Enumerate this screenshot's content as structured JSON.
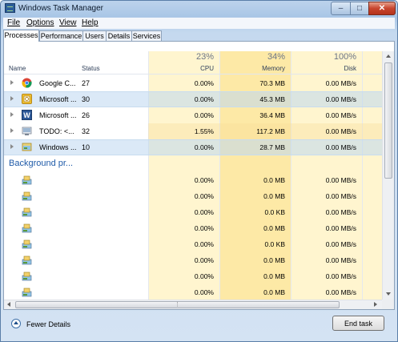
{
  "window": {
    "title": "Windows Task Manager",
    "controls": {
      "minimize": "–",
      "maximize": "□",
      "close": "✕"
    }
  },
  "menu": [
    "File",
    "Options",
    "View",
    "Help"
  ],
  "tabs": [
    {
      "label": "Processes",
      "active": true
    },
    {
      "label": "Performance",
      "active": false
    },
    {
      "label": "Users",
      "active": false
    },
    {
      "label": "Details",
      "active": false
    },
    {
      "label": "Services",
      "active": false
    }
  ],
  "columns": {
    "name": "Name",
    "status": "Status",
    "cpu": {
      "percent": "23%",
      "label": "CPU"
    },
    "memory": {
      "percent": "34%",
      "label": "Memory"
    },
    "disk": {
      "percent": "100%",
      "label": "Disk"
    }
  },
  "apps": [
    {
      "name": "Google C...",
      "status": "27",
      "cpu": "0.00%",
      "memory": "70.3 MB",
      "disk": "0.00 MB/s",
      "icon": "chrome-icon"
    },
    {
      "name": "Microsoft ...",
      "status": "30",
      "cpu": "0.00%",
      "memory": "45.3 MB",
      "disk": "0.00 MB/s",
      "icon": "outlook-icon"
    },
    {
      "name": "Microsoft ...",
      "status": "26",
      "cpu": "0.00%",
      "memory": "36.4 MB",
      "disk": "0.00 MB/s",
      "icon": "word-icon"
    },
    {
      "name": "TODO: <...",
      "status": "32",
      "cpu": "1.55%",
      "memory": "117.2 MB",
      "disk": "0.00 MB/s",
      "icon": "todo-app-icon"
    },
    {
      "name": "Windows ...",
      "status": "10",
      "cpu": "0.00%",
      "memory": "28.7 MB",
      "disk": "0.00 MB/s",
      "icon": "windows-explorer-icon"
    }
  ],
  "background_section": "Background pr...",
  "background": [
    {
      "cpu": "0.00%",
      "memory": "0.0 MB",
      "disk": "0.00 MB/s"
    },
    {
      "cpu": "0.00%",
      "memory": "0.0 MB",
      "disk": "0.00 MB/s"
    },
    {
      "cpu": "0.00%",
      "memory": "0.0 KB",
      "disk": "0.00 MB/s"
    },
    {
      "cpu": "0.00%",
      "memory": "0.0 MB",
      "disk": "0.00 MB/s"
    },
    {
      "cpu": "0.00%",
      "memory": "0.0 KB",
      "disk": "0.00 MB/s"
    },
    {
      "cpu": "0.00%",
      "memory": "0.0 MB",
      "disk": "0.00 MB/s"
    },
    {
      "cpu": "0.00%",
      "memory": "0.0 MB",
      "disk": "0.00 MB/s"
    },
    {
      "cpu": "0.00%",
      "memory": "0.0 MB",
      "disk": "0.00 MB/s"
    }
  ],
  "footer": {
    "fewer_details": "Fewer Details",
    "end_task": "End task"
  },
  "colors": {
    "cpu_shade": "#fff5cf",
    "memory_shade": "#fde9a6",
    "section_blue": "#1e5aa8",
    "selection": "#bed7f0"
  }
}
